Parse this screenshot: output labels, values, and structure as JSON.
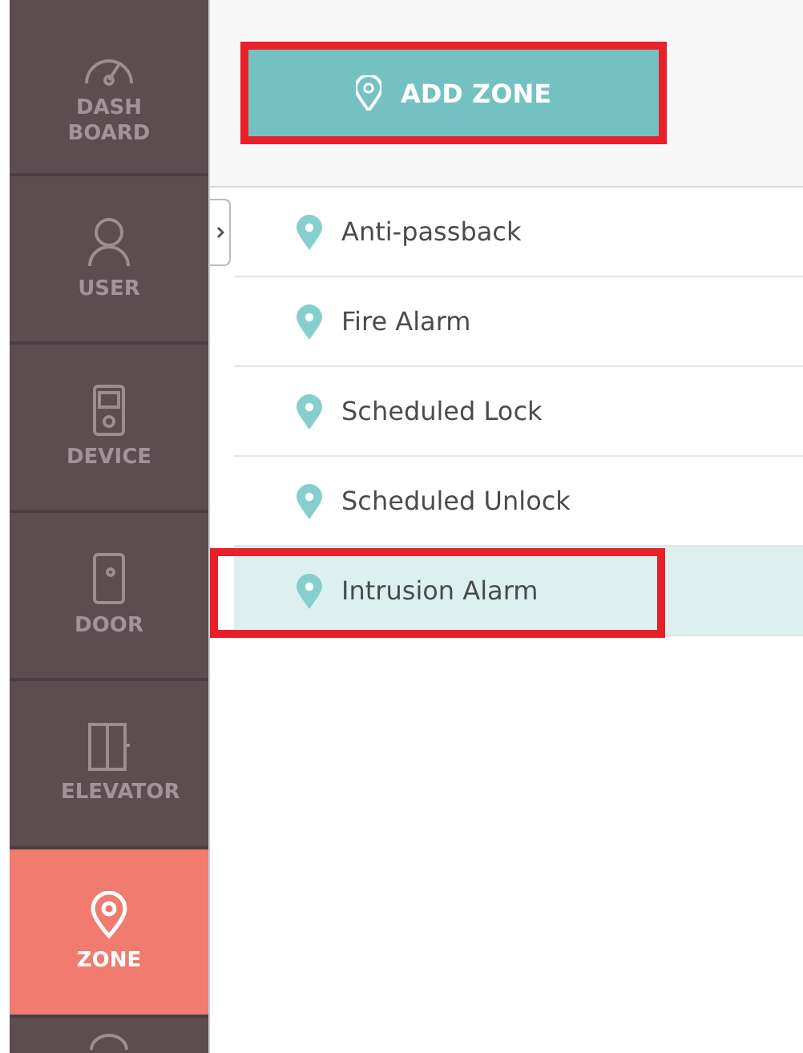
{
  "sidebar": {
    "items": [
      {
        "label": "DASH BOARD",
        "selected": false
      },
      {
        "label": "USER",
        "selected": false
      },
      {
        "label": "DEVICE",
        "selected": false
      },
      {
        "label": "DOOR",
        "selected": false
      },
      {
        "label": "ELEVATOR",
        "selected": false
      },
      {
        "label": "ZONE",
        "selected": true
      }
    ]
  },
  "add_button": {
    "label": "ADD ZONE",
    "highlighted": true
  },
  "zones": [
    {
      "name": "Anti-passback",
      "selected": false,
      "highlighted": false
    },
    {
      "name": "Fire Alarm",
      "selected": false,
      "highlighted": false
    },
    {
      "name": "Scheduled Lock",
      "selected": false,
      "highlighted": false
    },
    {
      "name": "Scheduled Unlock",
      "selected": false,
      "highlighted": false
    },
    {
      "name": "Intrusion Alarm",
      "selected": true,
      "highlighted": true
    }
  ]
}
